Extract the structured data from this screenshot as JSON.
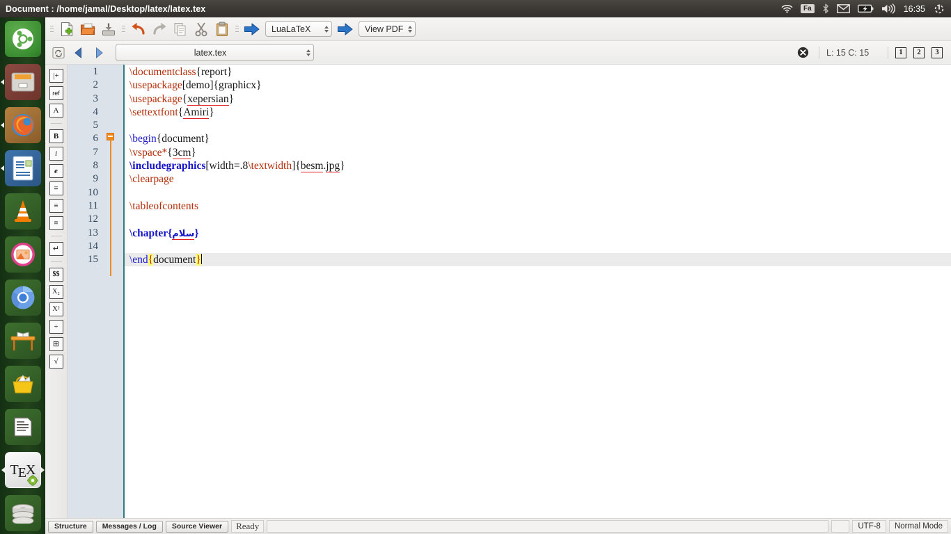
{
  "panel": {
    "title": "Document : /home/jamal/Desktop/latex/latex.tex",
    "clock": "16:35",
    "keyboard_indicator": "Fa",
    "tray_icons": [
      "wifi-icon",
      "keyboard-layout-indicator",
      "bluetooth-icon",
      "mail-icon",
      "battery-icon",
      "volume-icon",
      "clock",
      "session-menu-icon"
    ]
  },
  "launcher": {
    "items": [
      {
        "name": "ubuntu-dash",
        "label": "Dash home"
      },
      {
        "name": "files",
        "label": "Files"
      },
      {
        "name": "firefox",
        "label": "Firefox Web Browser"
      },
      {
        "name": "libreoffice",
        "label": "LibreOffice Writer"
      },
      {
        "name": "vlc",
        "label": "VLC media player"
      },
      {
        "name": "image-viewer",
        "label": "Shotwell"
      },
      {
        "name": "chromium",
        "label": "Chromium"
      },
      {
        "name": "desk",
        "label": "Desk"
      },
      {
        "name": "ubuntu-software",
        "label": "Ubuntu Software"
      },
      {
        "name": "text-document",
        "label": "Text Editor"
      },
      {
        "name": "texstudio",
        "label": "TeXstudio"
      },
      {
        "name": "disks",
        "label": "Disks"
      }
    ]
  },
  "toolbar": {
    "buttons": [
      {
        "name": "new-file-button",
        "icon": "new-document-icon"
      },
      {
        "name": "open-file-button",
        "icon": "open-folder-icon"
      },
      {
        "name": "save-file-button",
        "icon": "save-disk-icon"
      },
      {
        "name": "undo-button",
        "icon": "undo-arrow-icon"
      },
      {
        "name": "redo-button",
        "icon": "redo-arrow-icon"
      },
      {
        "name": "copy-button",
        "icon": "copy-icon"
      },
      {
        "name": "cut-button",
        "icon": "scissors-icon"
      },
      {
        "name": "paste-button",
        "icon": "clipboard-icon"
      },
      {
        "name": "build-run-button",
        "icon": "blue-arrow-icon"
      },
      {
        "name": "view-run-button",
        "icon": "blue-arrow-icon"
      }
    ],
    "compiler": "LuaLaTeX",
    "viewer": "View PDF"
  },
  "filebar": {
    "refresh_icon": "refresh-icon",
    "back_icon": "back-arrow-icon",
    "forward_icon": "forward-arrow-icon",
    "filename": "latex.tex",
    "close_icon": "close-circle-icon",
    "cursor_position": "L: 15 C: 15",
    "view_buttons": [
      "1",
      "2",
      "3"
    ]
  },
  "side_tools": [
    {
      "name": "insert-environment-tool",
      "glyph": "|+"
    },
    {
      "name": "insert-reference-tool",
      "glyph": "ref"
    },
    {
      "name": "font-size-tool",
      "glyph": "A"
    },
    {
      "name": "bold-tool",
      "glyph": "B"
    },
    {
      "name": "italic-tool",
      "glyph": "i"
    },
    {
      "name": "emphasis-tool",
      "glyph": "e"
    },
    {
      "name": "align-left-tool",
      "glyph": "≡"
    },
    {
      "name": "align-center-tool",
      "glyph": "≡"
    },
    {
      "name": "align-right-tool",
      "glyph": "≡"
    },
    {
      "name": "newline-tool",
      "glyph": "↵"
    },
    {
      "name": "math-mode-tool",
      "glyph": "$$"
    },
    {
      "name": "subscript-tool",
      "glyph": "X₂"
    },
    {
      "name": "superscript-tool",
      "glyph": "X²"
    },
    {
      "name": "fraction-tool",
      "glyph": "÷"
    },
    {
      "name": "matrix-tool",
      "glyph": "⊞"
    },
    {
      "name": "sqrt-tool",
      "glyph": "√"
    }
  ],
  "editor": {
    "line_numbers": [
      "1",
      "2",
      "3",
      "4",
      "5",
      "6",
      "7",
      "8",
      "9",
      "10",
      "11",
      "12",
      "13",
      "14",
      "15"
    ],
    "current_line": 15,
    "fold_marker_line": 6,
    "lines": [
      {
        "n": 1,
        "text": "\\documentclass{report}"
      },
      {
        "n": 2,
        "text": "\\usepackage[demo]{graphicx}"
      },
      {
        "n": 3,
        "text": "\\usepackage{xepersian}"
      },
      {
        "n": 4,
        "text": "\\settextfont{Amiri}"
      },
      {
        "n": 5,
        "text": ""
      },
      {
        "n": 6,
        "text": "\\begin{document}"
      },
      {
        "n": 7,
        "text": "\\vspace*{3cm}"
      },
      {
        "n": 8,
        "text": "\\includegraphics[width=.8\\textwidth]{besm.jpg}"
      },
      {
        "n": 9,
        "text": "\\clearpage"
      },
      {
        "n": 10,
        "text": ""
      },
      {
        "n": 11,
        "text": "\\tableofcontents"
      },
      {
        "n": 12,
        "text": ""
      },
      {
        "n": 13,
        "text": "\\chapter{سلام}"
      },
      {
        "n": 14,
        "text": ""
      },
      {
        "n": 15,
        "text": "\\end{document}"
      }
    ]
  },
  "statusbar": {
    "structure_label": "Structure",
    "messages_label": "Messages / Log",
    "source_viewer_label": "Source Viewer",
    "status": "Ready",
    "encoding": "UTF-8",
    "mode": "Normal Mode"
  },
  "colors": {
    "panel_bg": "#3c3935",
    "launcher_bg": "#2d5a22",
    "gutter_bg": "#dbe2ea",
    "fold_orange": "#f08a1e",
    "command_red": "#b52d09",
    "command_blue": "#1a1ad0",
    "brace_highlight": "#ffff7a",
    "current_line": "#ebebeb",
    "spell_underline": "#e02020"
  }
}
